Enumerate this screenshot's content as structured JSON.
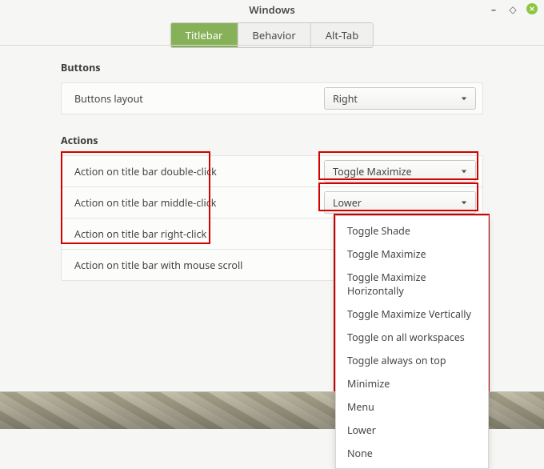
{
  "window": {
    "title": "Windows"
  },
  "tabs": [
    {
      "label": "Titlebar",
      "active": true
    },
    {
      "label": "Behavior",
      "active": false
    },
    {
      "label": "Alt-Tab",
      "active": false
    }
  ],
  "sections": {
    "buttons": {
      "title": "Buttons",
      "row": {
        "label": "Buttons layout",
        "value": "Right"
      }
    },
    "actions": {
      "title": "Actions",
      "rows": [
        {
          "label": "Action on title bar double-click",
          "value": "Toggle Maximize"
        },
        {
          "label": "Action on title bar middle-click",
          "value": "Lower"
        },
        {
          "label": "Action on title bar right-click",
          "value": ""
        },
        {
          "label": "Action on title bar with mouse scroll",
          "value": ""
        }
      ]
    }
  },
  "dropdown_options": [
    "Toggle Shade",
    "Toggle Maximize",
    "Toggle Maximize Horizontally",
    "Toggle Maximize Vertically",
    "Toggle on all workspaces",
    "Toggle always on top",
    "Minimize",
    "Menu",
    "Lower",
    "None"
  ],
  "colors": {
    "accent": "#87b158",
    "highlight": "#d40000",
    "close_btn": "#8cc63f"
  }
}
